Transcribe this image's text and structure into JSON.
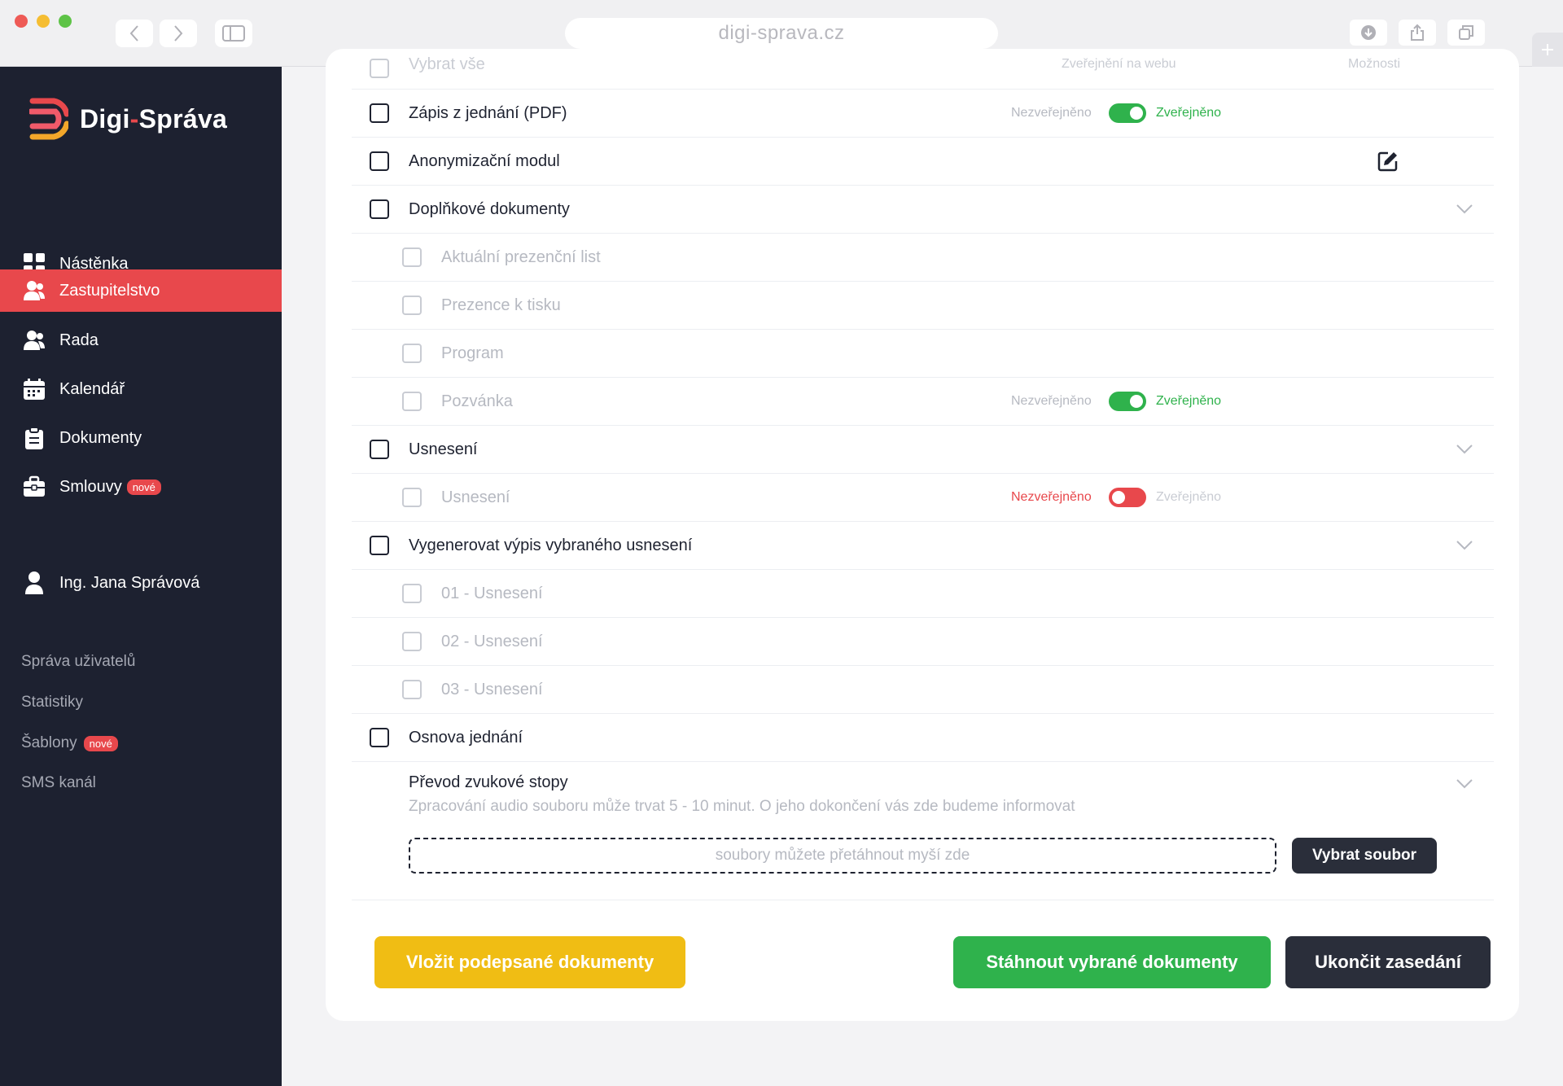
{
  "browser": {
    "url": "digi-sprava.cz",
    "traffic_lights": [
      "#ee5a56",
      "#f5bd32",
      "#5ec347"
    ]
  },
  "brand": {
    "name_left": "Digi",
    "name_dash": "-",
    "name_right": "Správa",
    "accent": "#e8484c"
  },
  "sidebar": {
    "nav": [
      {
        "label": "Nástěnka",
        "icon": "dashboard-icon"
      },
      {
        "label": "Zastupitelstvo",
        "icon": "users-icon",
        "active": true
      },
      {
        "label": "Rada",
        "icon": "users-icon"
      },
      {
        "label": "Kalendář",
        "icon": "calendar-icon"
      },
      {
        "label": "Dokumenty",
        "icon": "clipboard-icon"
      },
      {
        "label": "Smlouvy",
        "icon": "briefcase-icon",
        "badge": "nové"
      }
    ],
    "user": {
      "name": "Ing. Jana Správová",
      "icon": "user-icon"
    },
    "links": [
      {
        "label": "Správa uživatelů"
      },
      {
        "label": "Statistiky"
      },
      {
        "label": "Šablony",
        "badge": "nové"
      },
      {
        "label": "SMS kanál"
      }
    ]
  },
  "table": {
    "header_partial": {
      "select_all": "Vybrat vše",
      "published_web": "Zveřejnění na webu",
      "options": "Možnosti"
    },
    "status_labels": {
      "unpublished": "Nezveřejněno",
      "published": "Zveřejněno"
    },
    "rows": [
      {
        "label": "Zápis z jednání (PDF)",
        "level": 0,
        "toggle": "on"
      },
      {
        "label": "Anonymizační modul",
        "level": 0,
        "action": "edit-icon"
      },
      {
        "label": "Doplňkové dokumenty",
        "level": 0,
        "expand": true
      },
      {
        "label": "Aktuální prezenční list",
        "level": 1
      },
      {
        "label": "Prezence k tisku",
        "level": 1
      },
      {
        "label": "Program",
        "level": 1
      },
      {
        "label": "Pozvánka",
        "level": 1,
        "toggle": "on"
      },
      {
        "label": "Usnesení",
        "level": 0,
        "expand": true
      },
      {
        "label": "Usnesení",
        "level": 1,
        "toggle": "off"
      },
      {
        "label": "Vygenerovat výpis vybraného usnesení",
        "level": 0,
        "expand": true
      },
      {
        "label": "01 - Usnesení",
        "level": 1
      },
      {
        "label": "02 - Usnesení",
        "level": 1
      },
      {
        "label": "03 - Usnesení",
        "level": 1
      },
      {
        "label": "Osnova jednání",
        "level": 0
      }
    ]
  },
  "upload": {
    "title": "Převod zvukové stopy",
    "note": "Zpracování audio souboru může trvat 5 - 10 minut. O jeho dokončení vás zde budeme informovat",
    "dropzone_placeholder": "soubory můžete přetáhnout myší zde",
    "pick_button": "Vybrat soubor"
  },
  "actions": {
    "insert_signed": "Vložit podepsané dokumenty",
    "download_selected": "Stáhnout vybrané dokumenty",
    "end_session": "Ukončit zasedání"
  },
  "colors": {
    "green": "#2fb24c",
    "red": "#e8484c",
    "yellow": "#f0bd14",
    "dark": "#2a2e3a",
    "sidebar_bg": "#1d2130"
  }
}
